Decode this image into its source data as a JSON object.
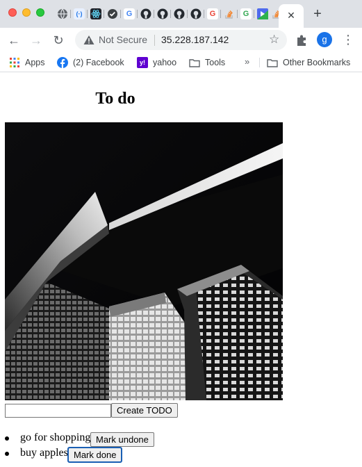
{
  "browser": {
    "address": {
      "security_label": "Not Secure",
      "url": "35.228.187.142"
    },
    "bookmarks": [
      {
        "label": "Apps",
        "icon": "apps-grid-icon"
      },
      {
        "label": "(2) Facebook",
        "icon": "facebook-icon"
      },
      {
        "label": "yahoo",
        "icon": "yahoo-icon"
      },
      {
        "label": "Tools",
        "icon": "folder-icon"
      }
    ],
    "bookmarks_overflow": "»",
    "other_bookmarks": "Other Bookmarks",
    "profile_initial": "g",
    "colors": {
      "accent": "#1a73e8",
      "tabstrip": "#dee1e6"
    }
  },
  "page": {
    "title": "To do",
    "input": {
      "value": "",
      "placeholder": ""
    },
    "create_label": "Create TODO",
    "todos": [
      {
        "text": "go for shopping",
        "action": "Mark undone"
      },
      {
        "text": "buy apples",
        "action": "Mark done"
      }
    ]
  }
}
